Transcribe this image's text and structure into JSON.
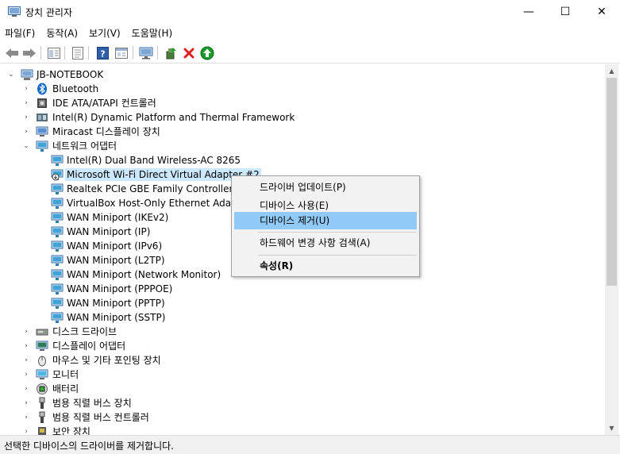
{
  "window": {
    "title": "장치 관리자",
    "minimize": "—",
    "maximize": "☐",
    "close": "✕"
  },
  "menu": [
    "파일(F)",
    "동작(A)",
    "보기(V)",
    "도움말(H)"
  ],
  "toolbar": {
    "icons": [
      "back-arrow-icon",
      "forward-arrow-icon",
      "view-icon",
      "properties-icon",
      "help-icon",
      "console-icon",
      "monitor-icon",
      "update-driver-icon",
      "remove-icon",
      "enable-icon"
    ],
    "remove_color": "#e02020",
    "enable_color": "#1a9a2a"
  },
  "tree": {
    "root": "JB-NOTEBOOK",
    "items": [
      {
        "label": "Bluetooth",
        "icon": "bluetooth-icon"
      },
      {
        "label": "IDE ATA/ATAPI 컨트롤러",
        "icon": "ide-controller-icon"
      },
      {
        "label": "Intel(R) Dynamic Platform and Thermal Framework",
        "icon": "chip-icon"
      },
      {
        "label": "Miracast 디스플레이 장치",
        "icon": "miracast-icon"
      },
      {
        "label": "네트워크 어댑터",
        "icon": "network-adapter-icon"
      },
      {
        "label": "Intel(R) Dual Band Wireless-AC 8265",
        "icon": "network-device-icon"
      },
      {
        "label": "Microsoft Wi-Fi Direct Virtual Adapter #2",
        "icon": "network-device-disabled-icon"
      },
      {
        "label": "Realtek PCIe GBE Family Controller",
        "icon": "network-device-icon"
      },
      {
        "label": "VirtualBox Host-Only Ethernet Adapter",
        "icon": "network-device-icon"
      },
      {
        "label": "WAN Miniport (IKEv2)",
        "icon": "network-device-icon"
      },
      {
        "label": "WAN Miniport (IP)",
        "icon": "network-device-icon"
      },
      {
        "label": "WAN Miniport (IPv6)",
        "icon": "network-device-icon"
      },
      {
        "label": "WAN Miniport (L2TP)",
        "icon": "network-device-icon"
      },
      {
        "label": "WAN Miniport (Network Monitor)",
        "icon": "network-device-icon"
      },
      {
        "label": "WAN Miniport (PPPOE)",
        "icon": "network-device-icon"
      },
      {
        "label": "WAN Miniport (PPTP)",
        "icon": "network-device-icon"
      },
      {
        "label": "WAN Miniport (SSTP)",
        "icon": "network-device-icon"
      },
      {
        "label": "디스크 드라이브",
        "icon": "disk-drive-icon"
      },
      {
        "label": "디스플레이 어댑터",
        "icon": "display-adapter-icon"
      },
      {
        "label": "마우스 및 기타 포인팅 장치",
        "icon": "mouse-icon"
      },
      {
        "label": "모니터",
        "icon": "monitor-icon"
      },
      {
        "label": "배터리",
        "icon": "battery-icon"
      },
      {
        "label": "범용 직렬 버스 장치",
        "icon": "usb-icon"
      },
      {
        "label": "범용 직렬 버스 컨트롤러",
        "icon": "usb-icon"
      },
      {
        "label": "보안 장치",
        "icon": "security-device-icon"
      }
    ]
  },
  "context_menu": {
    "update_driver": "드라이버 업데이트(P)",
    "enable_device": "디바이스 사용(E)",
    "uninstall_device": "디바이스 제거(U)",
    "scan_hardware": "하드웨어 변경 사항 검색(A)",
    "properties": "속성(R)"
  },
  "status": "선택한 디바이스의 드라이버를 제거합니다."
}
